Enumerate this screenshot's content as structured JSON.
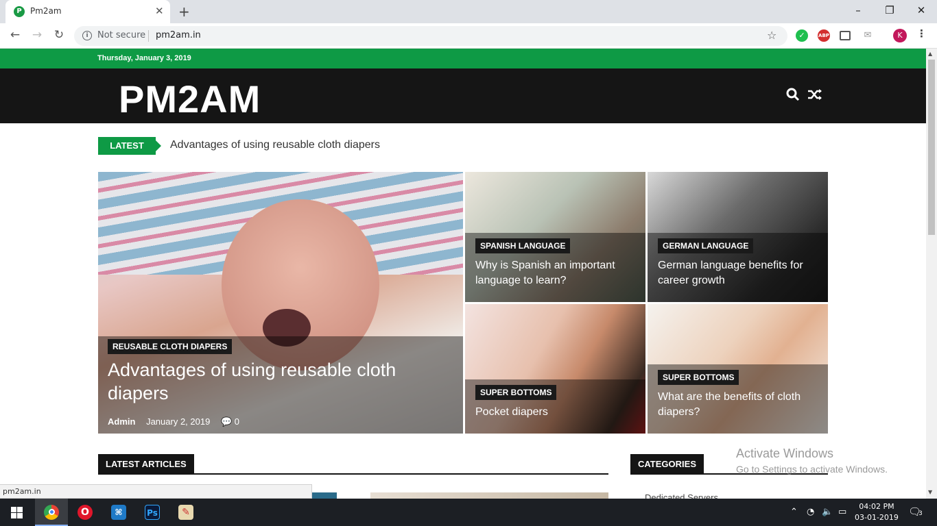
{
  "browser": {
    "tab_title": "Pm2am",
    "favicon_letter": "P",
    "tab_close": "✕",
    "new_tab": "+",
    "security_label": "Not secure",
    "url": "pm2am.in",
    "profile_letter": "K",
    "ext_abp": "ABP"
  },
  "site": {
    "date": "Thursday, January 3, 2019",
    "logo": "PM2AM",
    "latest_label": "LATEST",
    "latest_headline": "Advantages of using reusable cloth diapers"
  },
  "featured": [
    {
      "category": "REUSABLE CLOTH DIAPERS",
      "title": "Advantages of using reusable cloth diapers",
      "author": "Admin",
      "date": "January 2, 2019",
      "comments": "0"
    },
    {
      "category": "SPANISH LANGUAGE",
      "title": "Why is Spanish an important language to learn?"
    },
    {
      "category": "GERMAN LANGUAGE",
      "title": "German language benefits for career growth"
    },
    {
      "category": "SUPER BOTTOMS",
      "title": "Pocket diapers"
    },
    {
      "category": "SUPER BOTTOMS",
      "title": "What are the benefits of cloth diapers?"
    }
  ],
  "sections": {
    "latest_articles": "LATEST ARTICLES",
    "categories": "CATEGORIES",
    "first_category": "Dedicated Servers"
  },
  "os": {
    "watermark_title": "Activate Windows",
    "watermark_sub": "Go to Settings to activate Windows.",
    "status_url": "pm2am.in",
    "time": "04:02 PM",
    "date": "03-01-2019",
    "notifications": "3"
  },
  "colors": {
    "accent_green": "#0e9a45",
    "header_dark": "#151515"
  }
}
